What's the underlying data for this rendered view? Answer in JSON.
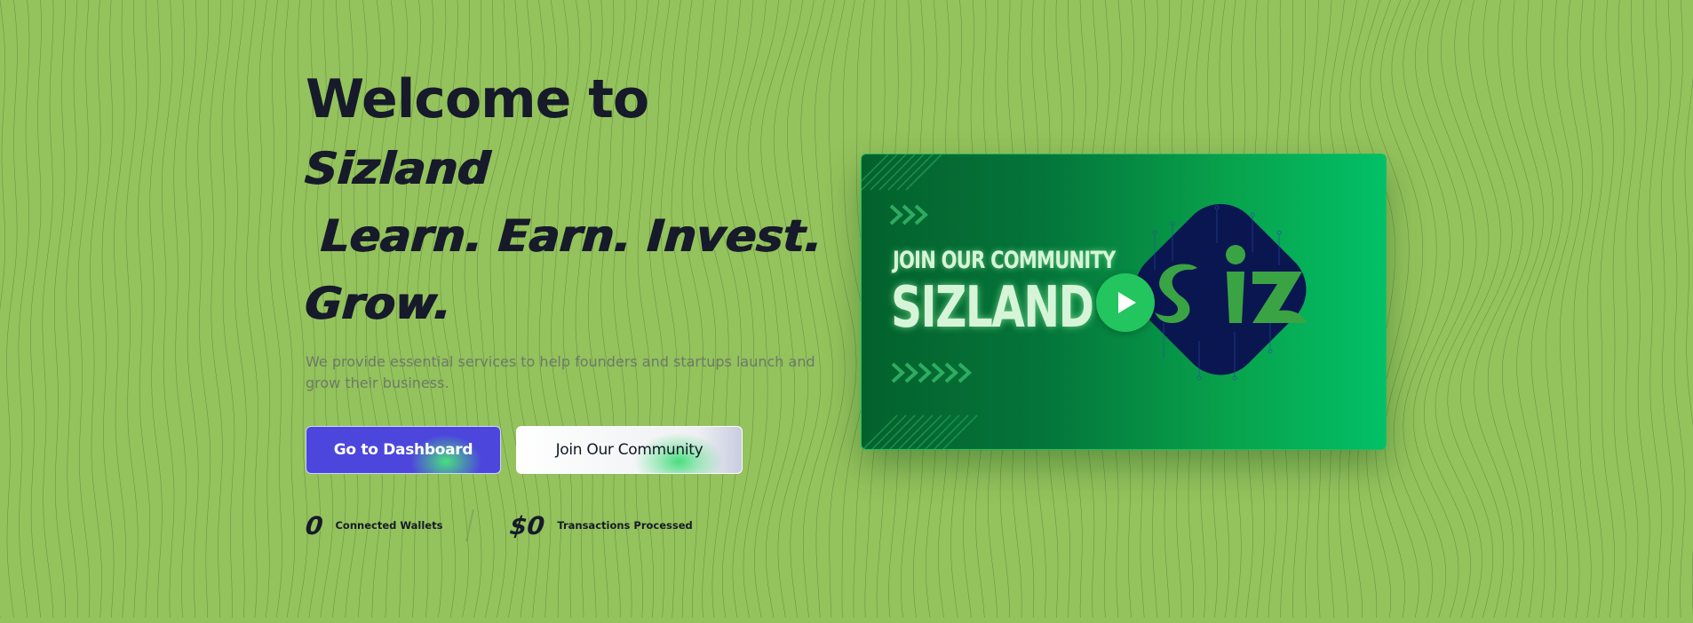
{
  "hero": {
    "title_line1": "Welcome to",
    "title_brand": "Sizland",
    "title_tagline": "Learn. Earn. Invest.",
    "title_tagline_end": "Grow.",
    "subtitle": "We provide essential services to help founders and startups launch and grow their business."
  },
  "buttons": {
    "dashboard_label": "Go to Dashboard",
    "community_label": "Join Our Community"
  },
  "stats": [
    {
      "value": "0",
      "label": "Connected Wallets"
    },
    {
      "value": "$0",
      "label": "Transactions Processed"
    }
  ],
  "video": {
    "small_text": "JOIN OUR COMMUNITY",
    "big_text": "SIZLAND",
    "logo_text": "siz",
    "play_icon": "play-icon"
  },
  "colors": {
    "background": "#94c25c",
    "primary_button": "#4c46dd",
    "accent_green": "#22c55e",
    "text_dark": "#161a2a",
    "logo_navy": "#0a1650"
  }
}
